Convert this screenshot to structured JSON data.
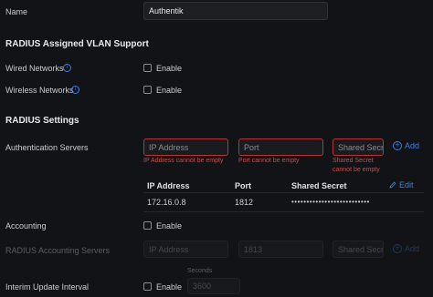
{
  "name": {
    "label": "Name",
    "value": "Authentik"
  },
  "vlan": {
    "heading": "RADIUS Assigned VLAN Support",
    "wired_label": "Wired Networks",
    "wireless_label": "Wireless Networks",
    "enable_label": "Enable"
  },
  "radius": {
    "heading": "RADIUS Settings",
    "auth_label": "Authentication Servers",
    "ip_placeholder": "IP Address",
    "port_placeholder": "Port",
    "secret_placeholder": "Shared Secret",
    "ip_error": "IP Address cannot be empty",
    "port_error": "Port cannot be empty",
    "secret_error_1": "Shared Secret",
    "secret_error_2": "cannot be empty",
    "add_label": "Add",
    "table": {
      "headers": [
        "IP Address",
        "Port",
        "Shared Secret"
      ],
      "edit_label": "Edit",
      "rows": [
        {
          "ip": "172.16.0.8",
          "port": "1812",
          "secret": "••••••••••••••••••••••••••"
        }
      ]
    }
  },
  "accounting": {
    "label": "Accounting",
    "enable_label": "Enable",
    "servers_label": "RADIUS Accounting Servers",
    "ip_placeholder": "IP Address",
    "port_value": "1813",
    "secret_placeholder": "Shared Secret",
    "add_label": "Add"
  },
  "interim": {
    "label": "Interim Update Interval",
    "enable_label": "Enable",
    "unit_label": "Seconds",
    "value": "3600"
  },
  "colors": {
    "accent": "#3d7fe0",
    "error": "#d04a4a",
    "background": "#121316"
  },
  "icons": {
    "info": "info-icon",
    "add": "plus-circle-icon",
    "edit": "pencil-icon"
  }
}
